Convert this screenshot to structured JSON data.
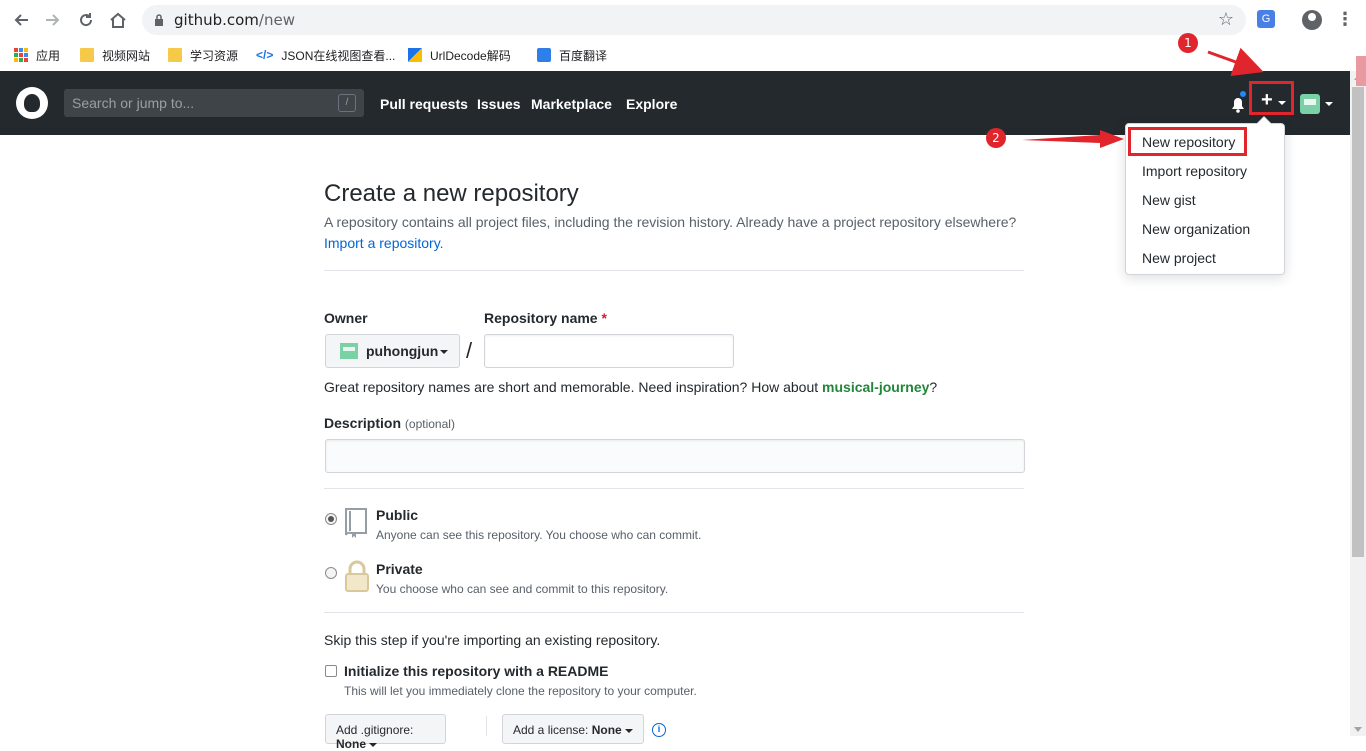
{
  "browser": {
    "url_host": "github.com",
    "url_path": "/new",
    "bookmarks": [
      {
        "label": "应用",
        "icon": "apps-icon"
      },
      {
        "label": "视频网站",
        "icon": "folder-icon"
      },
      {
        "label": "学习资源",
        "icon": "folder-icon"
      },
      {
        "label": "JSON在线视图查看...",
        "icon": "json-icon"
      },
      {
        "label": "UrlDecode解码",
        "icon": "urldecode-icon"
      },
      {
        "label": "百度翻译",
        "icon": "translate-icon"
      }
    ],
    "translate_icon_text": "G"
  },
  "header": {
    "search_placeholder": "Search or jump to...",
    "search_shortcut": "/",
    "nav": [
      "Pull requests",
      "Issues",
      "Marketplace",
      "Explore"
    ]
  },
  "dropdown": {
    "items": [
      "New repository",
      "Import repository",
      "New gist",
      "New organization",
      "New project"
    ]
  },
  "annotations": {
    "badge1": "1",
    "badge2": "2"
  },
  "main": {
    "title": "Create a new repository",
    "subtitle": "A repository contains all project files, including the revision history. Already have a project repository elsewhere?",
    "import_link": "Import a repository.",
    "owner_label": "Owner",
    "owner_name": "puhongjun",
    "separator": "/",
    "repo_label": "Repository name",
    "required_mark": "*",
    "repo_value": "",
    "hint_prefix": "Great repository names are short and memorable. Need inspiration? How about ",
    "hint_suggestion": "musical-journey",
    "hint_suffix": "?",
    "description_label": "Description",
    "description_optional": "(optional)",
    "description_value": "",
    "public_title": "Public",
    "public_desc": "Anyone can see this repository. You choose who can commit.",
    "private_title": "Private",
    "private_desc": "You choose who can see and commit to this repository.",
    "skip_text": "Skip this step if you're importing an existing repository.",
    "readme_label": "Initialize this repository with a README",
    "readme_desc": "This will let you immediately clone the repository to your computer.",
    "gitignore_label": "Add .gitignore:",
    "gitignore_value": "None",
    "license_label": "Add a license:",
    "license_value": "None",
    "info_icon_text": "i"
  },
  "colors": {
    "header_bg": "#24292e",
    "annotation_red": "#e0262c",
    "link_blue": "#0366d6",
    "suggestion_green": "#22863a"
  }
}
